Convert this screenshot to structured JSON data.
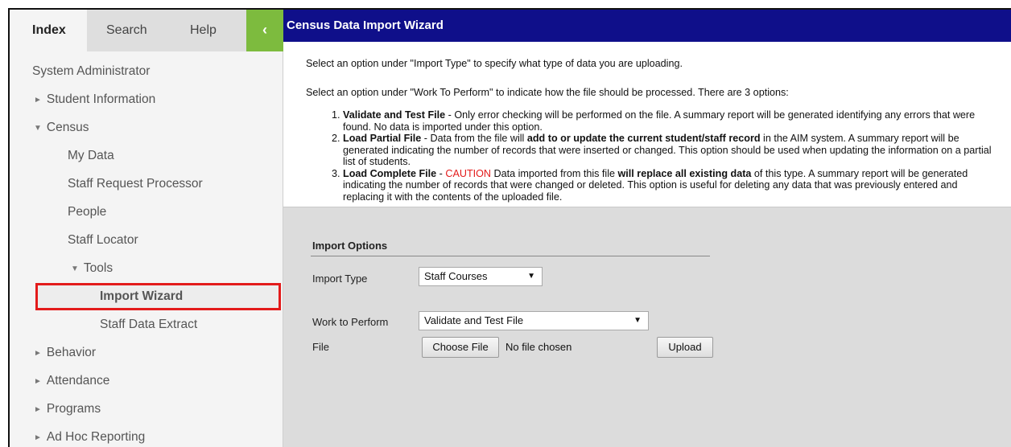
{
  "sidebar": {
    "tabs": [
      {
        "label": "Index",
        "active": true
      },
      {
        "label": "Search",
        "active": false
      },
      {
        "label": "Help",
        "active": false
      }
    ],
    "collapse_glyph": "‹",
    "items": [
      {
        "label": "System Administrator"
      },
      {
        "label": "Student Information",
        "arrow": "►"
      },
      {
        "label": "Census",
        "arrow": "▼"
      },
      {
        "label": "My Data"
      },
      {
        "label": "Staff Request Processor"
      },
      {
        "label": "People"
      },
      {
        "label": "Staff Locator"
      },
      {
        "label": "Tools",
        "arrow": "▼"
      },
      {
        "label": "Import Wizard",
        "selected": true
      },
      {
        "label": "Staff Data Extract"
      },
      {
        "label": "Behavior",
        "arrow": "►"
      },
      {
        "label": "Attendance",
        "arrow": "►"
      },
      {
        "label": "Programs",
        "arrow": "►"
      },
      {
        "label": "Ad Hoc Reporting",
        "arrow": "►"
      }
    ]
  },
  "main": {
    "title": "Census Data Import Wizard",
    "intro1": "Select an option under \"Import Type\" to specify what type of data you are uploading.",
    "intro2": "Select an option under \"Work To Perform\" to indicate how the file should be processed. There are 3 options:",
    "options": [
      {
        "num": "1.",
        "bold": "Validate and Test File",
        "text_a": " - Only error checking will be performed on the file. A summary report will be generated identifying any errors that were found. No data is imported under this option."
      },
      {
        "num": "2.",
        "bold": "Load Partial File",
        "text_a": " - Data from the file will ",
        "bold2": "add to or update the current student/staff record",
        "text_b": " in the AIM system. A summary report will be generated indicating the number of records that were inserted or changed. This option should be used when updating the information on a partial list of students."
      },
      {
        "num": "3.",
        "bold": "Load Complete File",
        "text_a": " - ",
        "caution": "CAUTION",
        "text_b": " Data imported from this file ",
        "bold2": "will replace all existing data",
        "text_c": " of this type. A summary report will be generated indicating the number of records that were changed or deleted. This option is useful for deleting any data that was previously entered and replacing it with the contents of the uploaded file."
      }
    ],
    "import_options": {
      "heading": "Import Options",
      "import_type_label": "Import Type",
      "import_type_value": "Staff Courses",
      "work_label": "Work to Perform",
      "work_value": "Validate and Test File",
      "file_label": "File",
      "choose_file": "Choose File",
      "no_file": "No file chosen",
      "upload": "Upload"
    }
  },
  "colors": {
    "header_bg": "#0f0f8a",
    "collapse_bg": "#7dbb3e",
    "highlight_border": "#e31b1b",
    "caution": "#e31b1b"
  }
}
